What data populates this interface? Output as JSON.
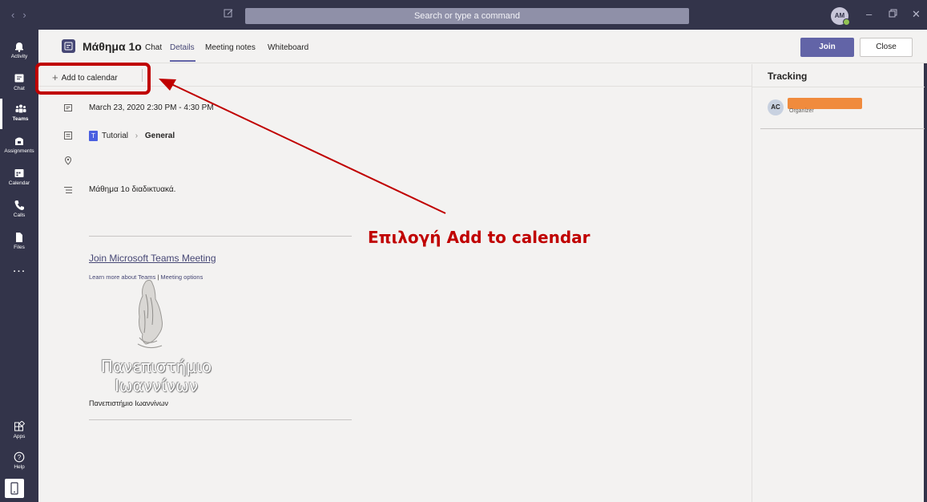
{
  "titlebar": {
    "search_placeholder": "Search or type a command",
    "user_initials": "AM"
  },
  "rail": {
    "items": [
      {
        "label": "Activity",
        "icon": "bell-icon"
      },
      {
        "label": "Chat",
        "icon": "chat-icon"
      },
      {
        "label": "Teams",
        "icon": "teams-icon"
      },
      {
        "label": "Assignments",
        "icon": "assignments-icon"
      },
      {
        "label": "Calendar",
        "icon": "calendar-icon"
      },
      {
        "label": "Calls",
        "icon": "phone-icon"
      },
      {
        "label": "Files",
        "icon": "file-icon"
      },
      {
        "label": "Apps",
        "icon": "apps-icon"
      },
      {
        "label": "Help",
        "icon": "help-icon"
      }
    ],
    "more": "..."
  },
  "header": {
    "meeting_title": "Μάθημα 1ο",
    "tabs": [
      {
        "label": "Chat"
      },
      {
        "label": "Details"
      },
      {
        "label": "Meeting notes"
      },
      {
        "label": "Whiteboard"
      }
    ],
    "join_label": "Join",
    "close_label": "Close"
  },
  "toolbar": {
    "add_to_calendar": "Add to calendar"
  },
  "details": {
    "datetime": "March 23, 2020 2:30 PM - 4:30 PM",
    "team_initial": "T",
    "team": "Tutorial",
    "channel": "General",
    "description": "Μάθημα 1ο διαδικτυακά.",
    "join_link": "Join Microsoft Teams Meeting",
    "learn_more": "Learn more about Teams",
    "meeting_options": "Meeting options",
    "logo_line1": "Πανεπιστήμιο",
    "logo_line2": "Ιωαννίνων",
    "university": "Πανεπιστήμιο Ιωαννίνων"
  },
  "annotation": {
    "text": "Επιλογή Add to calendar",
    "color": "#c00000"
  },
  "tracking": {
    "heading": "Tracking",
    "initials": "AC",
    "role": "Organizer"
  }
}
